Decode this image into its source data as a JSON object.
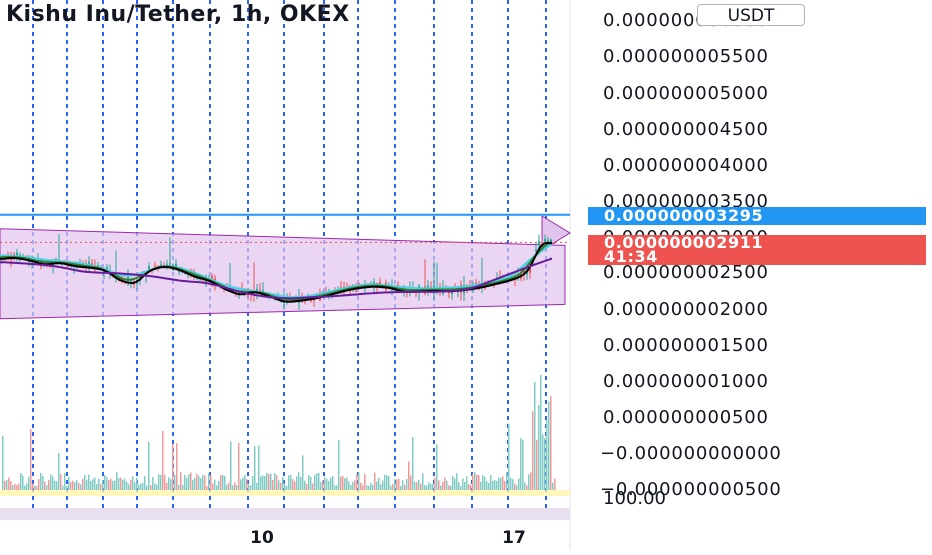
{
  "header": {
    "title": "Kishu Inu/Tether, 1h, OKEX",
    "currency_badge": "USDT"
  },
  "price_tags": {
    "level_price": "0.000000003295",
    "last_price": "0.000000002911",
    "countdown": "41:34"
  },
  "colors": {
    "grid_dotted": "#2962ff",
    "level_line": "#2196f3",
    "channel_fill": "#e1c4ec",
    "channel_edge": "#9c27b0",
    "up_candle": "#26a69a",
    "down_candle": "#ef5350",
    "ma_black": "#000000",
    "ma_green": "#2e7d32",
    "ma_cyan": "#4dd0e1",
    "ma_purple": "#6a1b9a",
    "volume_up": "#80cbc4",
    "volume_down": "#ef9a9a",
    "last_price_line": "#ef5350"
  },
  "chart_data": {
    "type": "candlestick",
    "title": "Kishu Inu/Tether, 1h, OKEX",
    "x_tick_labels": [
      "10",
      "17"
    ],
    "y_axis_ticks": [
      "0.000000006000",
      "0.000000005500",
      "0.000000005000",
      "0.000000004500",
      "0.000000004000",
      "0.000000003500",
      "0.000000003000",
      "0.000000002500",
      "0.000000002000",
      "0.000000001500",
      "0.000000001000",
      "0.000000000500",
      "−0.000000000000",
      "−0.000000000500"
    ],
    "y_axis_partial_label": "100.00",
    "ylim": [
      -5e-10,
      6e-09
    ],
    "horizontal_level": 3.295e-09,
    "last_price": 2.911e-09,
    "price_series_approx": [
      [
        0,
        2.7e-09
      ],
      [
        15,
        2.72e-09
      ],
      [
        30,
        2.68e-09
      ],
      [
        45,
        2.62e-09
      ],
      [
        60,
        2.65e-09
      ],
      [
        75,
        2.6e-09
      ],
      [
        90,
        2.58e-09
      ],
      [
        105,
        2.55e-09
      ],
      [
        120,
        2.4e-09
      ],
      [
        135,
        2.35e-09
      ],
      [
        150,
        2.55e-09
      ],
      [
        165,
        2.6e-09
      ],
      [
        180,
        2.55e-09
      ],
      [
        195,
        2.45e-09
      ],
      [
        210,
        2.4e-09
      ],
      [
        225,
        2.28e-09
      ],
      [
        240,
        2.2e-09
      ],
      [
        255,
        2.25e-09
      ],
      [
        270,
        2.18e-09
      ],
      [
        285,
        2.1e-09
      ],
      [
        300,
        2.12e-09
      ],
      [
        315,
        2.15e-09
      ],
      [
        330,
        2.2e-09
      ],
      [
        345,
        2.26e-09
      ],
      [
        360,
        2.3e-09
      ],
      [
        375,
        2.32e-09
      ],
      [
        390,
        2.3e-09
      ],
      [
        405,
        2.24e-09
      ],
      [
        420,
        2.25e-09
      ],
      [
        435,
        2.26e-09
      ],
      [
        450,
        2.25e-09
      ],
      [
        465,
        2.27e-09
      ],
      [
        480,
        2.3e-09
      ],
      [
        495,
        2.35e-09
      ],
      [
        510,
        2.4e-09
      ],
      [
        520,
        2.45e-09
      ],
      [
        530,
        2.55e-09
      ],
      [
        538,
        2.85e-09
      ],
      [
        545,
        2.95e-09
      ],
      [
        552,
        2.91e-09
      ]
    ],
    "channel_upper": [
      [
        0,
        3.1e-09
      ],
      [
        565,
        2.87e-09
      ]
    ],
    "channel_lower": [
      [
        0,
        1.85e-09
      ],
      [
        565,
        2.05e-09
      ]
    ],
    "x_range": [
      0,
      565
    ]
  }
}
